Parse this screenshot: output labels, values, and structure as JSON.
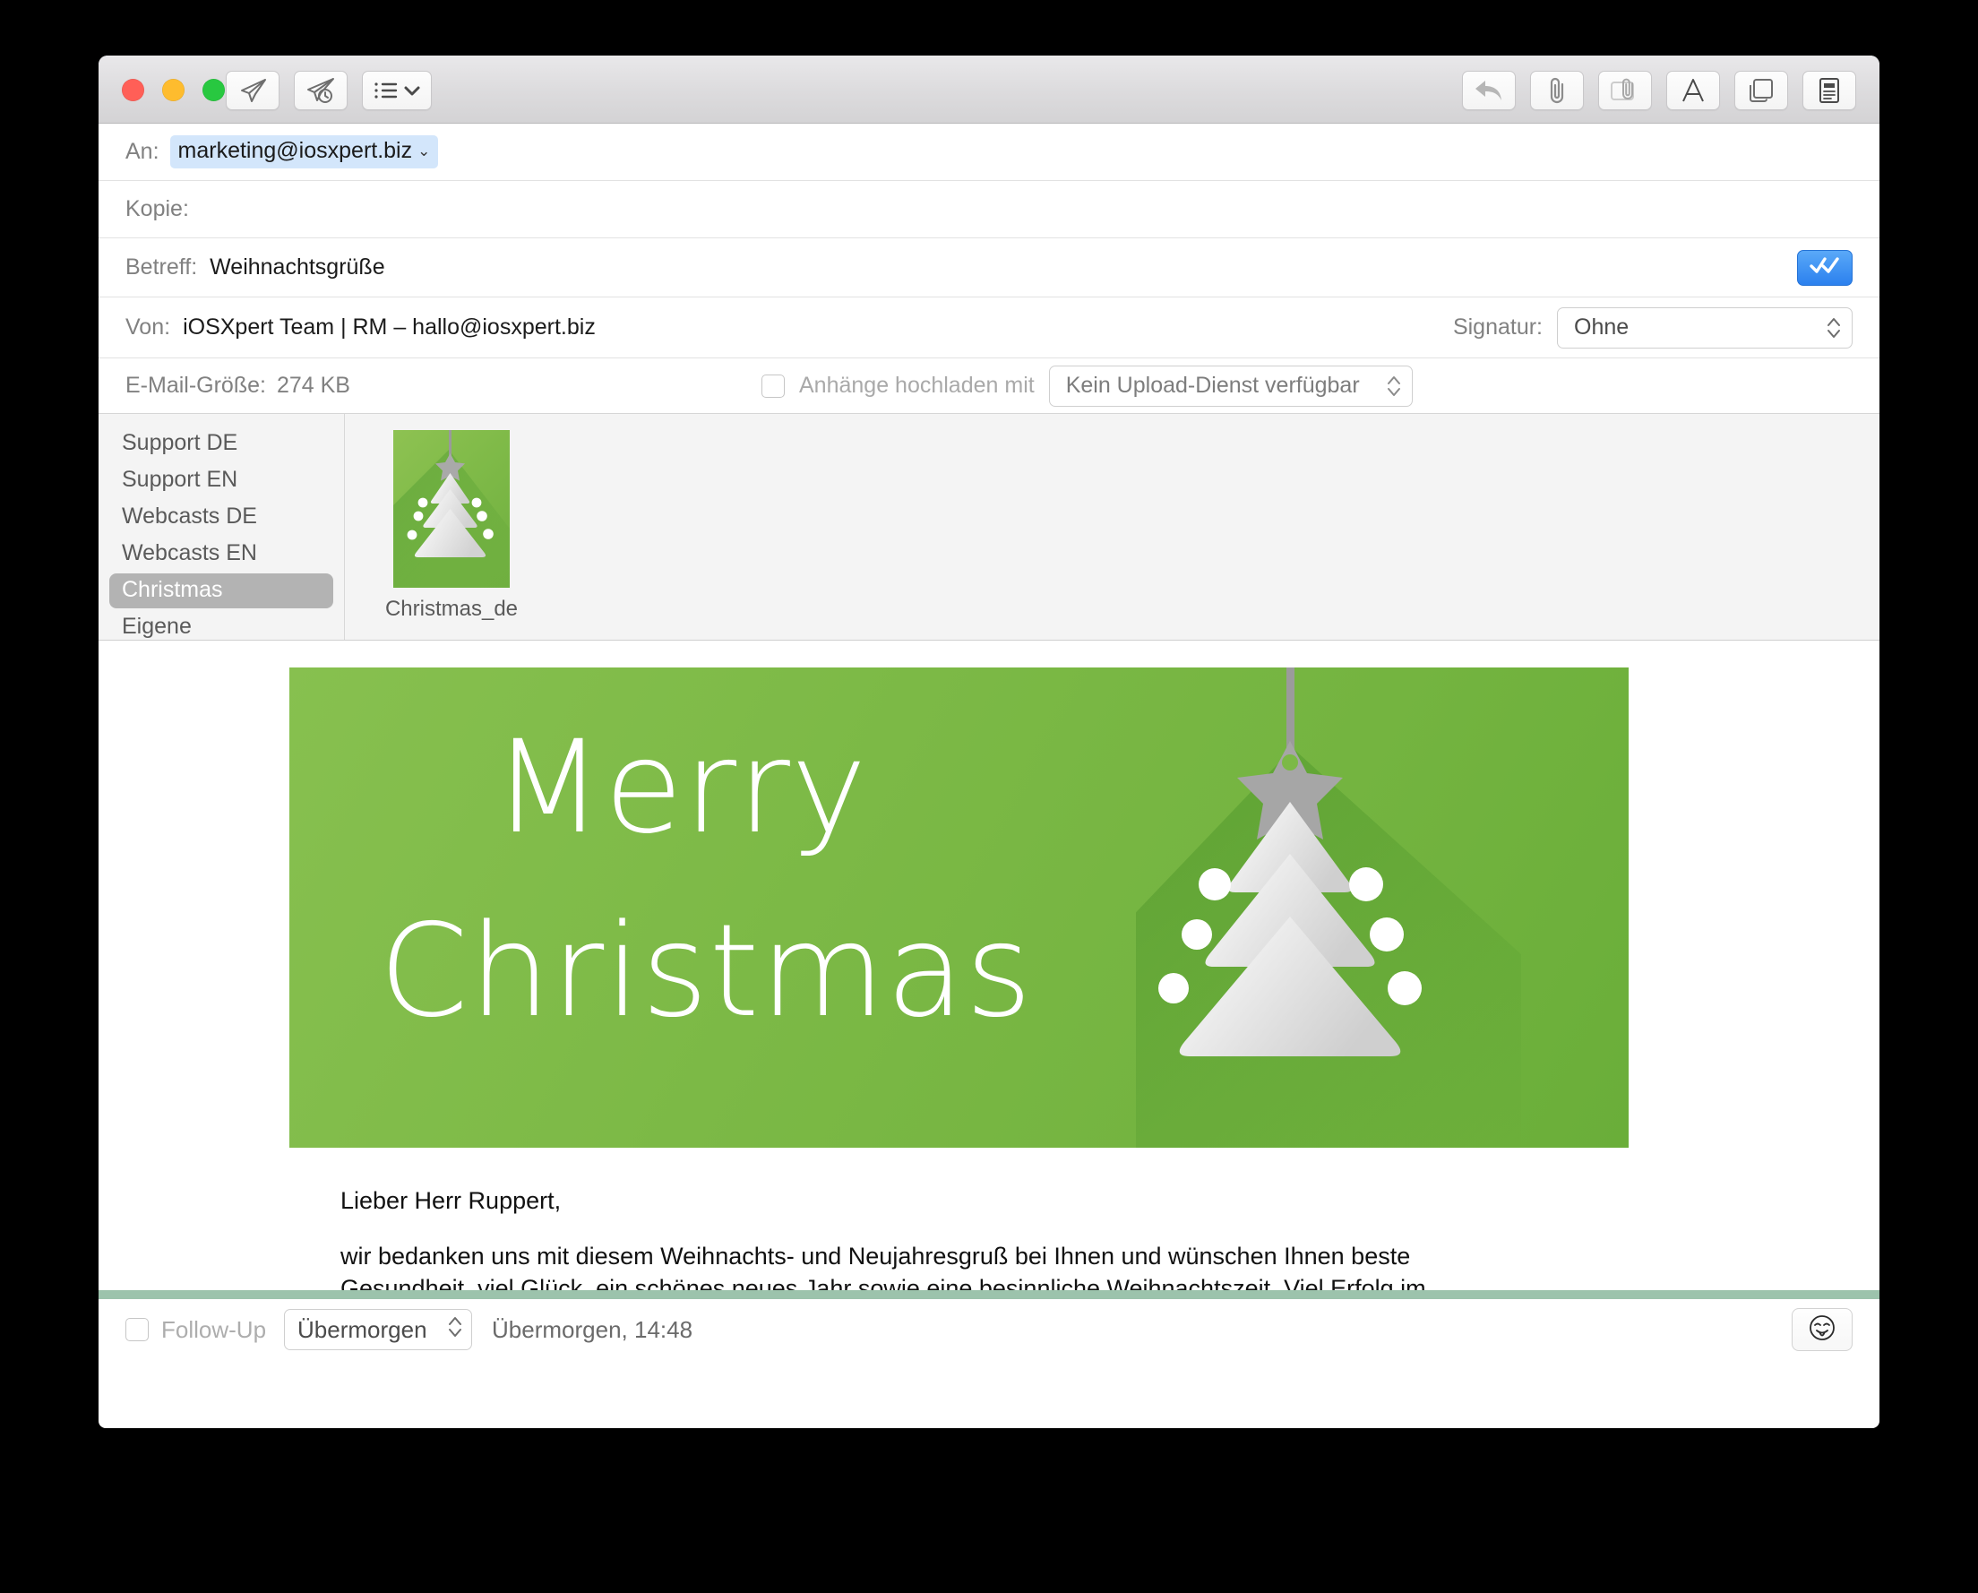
{
  "window": {
    "traffic_lights": [
      "close",
      "minimize",
      "zoom"
    ],
    "toolbar_left": [
      {
        "name": "send-button",
        "icon": "paper-plane-icon"
      },
      {
        "name": "send-later-button",
        "icon": "paper-plane-clock-icon"
      },
      {
        "name": "templates-menu-button",
        "icon": "list-chevron-icon"
      }
    ],
    "toolbar_right": [
      {
        "name": "reply-button",
        "icon": "reply-arrow-icon"
      },
      {
        "name": "attach-button",
        "icon": "paperclip-icon"
      },
      {
        "name": "attach-window-button",
        "icon": "paperclip-window-icon"
      },
      {
        "name": "format-button",
        "icon": "letter-a-icon"
      },
      {
        "name": "stationery-button",
        "icon": "stacked-pages-icon"
      },
      {
        "name": "sidebar-button",
        "icon": "document-lines-icon"
      }
    ]
  },
  "header": {
    "to_label": "An:",
    "to_recipient": "marketing@iosxpert.biz",
    "to_recipient_chevron": "⌄",
    "cc_label": "Kopie:",
    "cc_value": "",
    "subject_label": "Betreff:",
    "subject_value": "Weihnachtsgrüße",
    "from_label": "Von:",
    "from_value": "iOSXpert Team | RM – hallo@iosxpert.biz",
    "signature_label": "Signatur:",
    "signature_value": "Ohne",
    "size_label": "E-Mail-Größe:",
    "size_value": "274 KB",
    "upload_checkbox_label": "Anhänge hochladen mit",
    "upload_service_value": "Kein Upload-Dienst verfügbar",
    "send_confirm_icon": "double-check-icon"
  },
  "templates": {
    "categories": [
      {
        "label": "Support DE",
        "selected": false
      },
      {
        "label": "Support EN",
        "selected": false
      },
      {
        "label": "Webcasts DE",
        "selected": false
      },
      {
        "label": "Webcasts EN",
        "selected": false
      },
      {
        "label": "Christmas",
        "selected": true
      },
      {
        "label": "Eigene",
        "selected": false
      }
    ],
    "items": [
      {
        "label": "Christmas_de",
        "thumbnail": "christmas-tree-green-card"
      }
    ]
  },
  "message": {
    "banner": {
      "line1": "Merry",
      "line2": "Christmas",
      "graphic": "hanging-christmas-tree-icon",
      "background_color": "#7cb946",
      "text_color": "#ffffff"
    },
    "body_lines": [
      "Lieber Herr Ruppert,",
      "wir bedanken uns mit diesem Weihnachts- und Neujahresgruß bei Ihnen und wünschen Ihnen beste",
      "Gesundheit, viel Glück, ein schönes neues Jahr sowie eine besinnliche Weihnachtszeit. Viel Erfolg im"
    ]
  },
  "footer": {
    "followup_label": "Follow-Up",
    "followup_value": "Übermorgen",
    "followup_when": "Übermorgen, 14:48",
    "smiley_icon": "smiley-tongue-icon",
    "divider_color": "#9cc3ac"
  }
}
